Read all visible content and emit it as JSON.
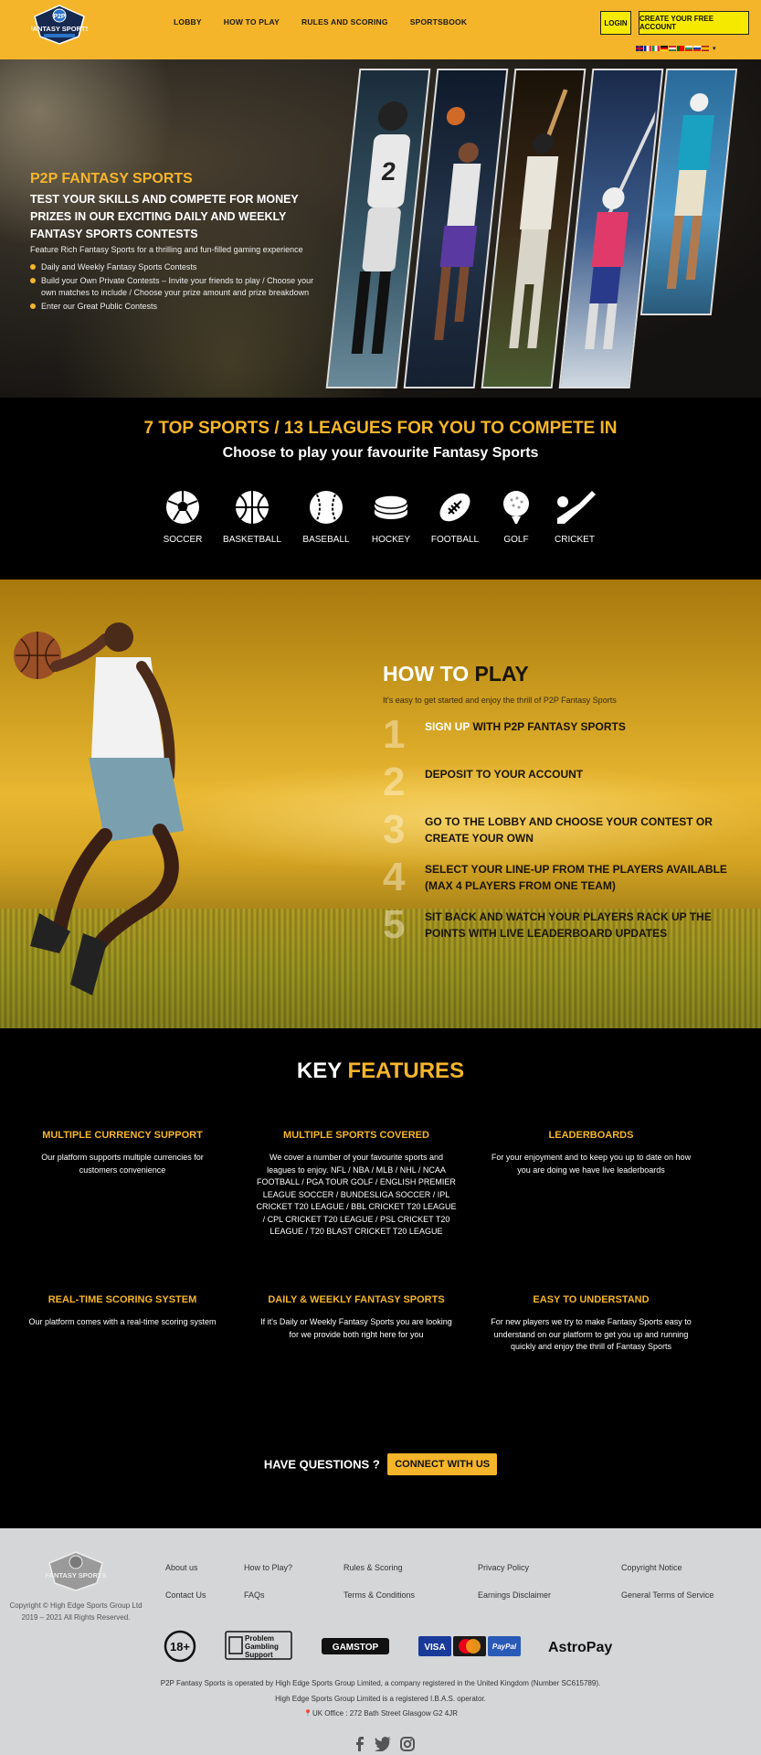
{
  "header": {
    "logo_text": "FANTASY SPORTS",
    "nav": [
      "LOBBY",
      "HOW TO PLAY",
      "RULES AND SCORING",
      "SPORTSBOOK"
    ],
    "login_label": "LOGIN",
    "create_label": "CREATE YOUR FREE ACCOUNT",
    "language_flags": [
      "en",
      "fr",
      "it",
      "de",
      "hu",
      "pt",
      "bg",
      "ru",
      "es"
    ]
  },
  "hero": {
    "title": "P2P FANTASY SPORTS",
    "subtitle": "TEST YOUR SKILLS AND COMPETE FOR MONEY PRIZES IN OUR EXCITING DAILY AND WEEKLY FANTASY SPORTS CONTESTS",
    "description": "Feature Rich Fantasy Sports for a thrilling and fun-filled gaming experience",
    "bullets": [
      "Daily and Weekly Fantasy Sports Contests",
      "Build your Own Private Contests – Invite your friends to play / Choose your own matches to include / Choose your prize amount and prize breakdown",
      "Enter our Great Public Contests"
    ]
  },
  "sports": {
    "title": "7 TOP SPORTS / 13 LEAGUES FOR YOU TO COMPETE IN",
    "subtitle": "Choose to play your favourite Fantasy Sports",
    "items": [
      {
        "label": "SOCCER",
        "icon": "soccer-ball-icon"
      },
      {
        "label": "BASKETBALL",
        "icon": "basketball-icon"
      },
      {
        "label": "BASEBALL",
        "icon": "baseball-icon"
      },
      {
        "label": "HOCKEY",
        "icon": "hockey-puck-icon"
      },
      {
        "label": "FOOTBALL",
        "icon": "football-icon"
      },
      {
        "label": "GOLF",
        "icon": "golf-ball-icon"
      },
      {
        "label": "CRICKET",
        "icon": "cricket-bat-icon"
      }
    ]
  },
  "howto": {
    "title_a": "HOW TO",
    "title_b": "PLAY",
    "intro": "It's easy to get started and enjoy the thrill of P2P Fantasy Sports",
    "steps": [
      {
        "num": "1",
        "highlight": "SIGN UP",
        "text": " WITH P2P FANTASY SPORTS"
      },
      {
        "num": "2",
        "highlight": "",
        "text": "DEPOSIT TO YOUR ACCOUNT"
      },
      {
        "num": "3",
        "highlight": "",
        "text": "GO TO THE LOBBY AND CHOOSE YOUR CONTEST OR CREATE YOUR OWN"
      },
      {
        "num": "4",
        "highlight": "",
        "text": "SELECT YOUR LINE-UP FROM THE PLAYERS AVAILABLE (MAX 4 PLAYERS FROM ONE TEAM)"
      },
      {
        "num": "5",
        "highlight": "",
        "text": "SIT BACK AND WATCH YOUR PLAYERS RACK UP THE POINTS WITH LIVE LEADERBOARD UPDATES"
      }
    ]
  },
  "features": {
    "title_a": "KEY",
    "title_b": "FEATURES",
    "items": [
      {
        "title": "MULTIPLE CURRENCY SUPPORT",
        "text": "Our platform supports multiple currencies for customers convenience"
      },
      {
        "title": "MULTIPLE SPORTS COVERED",
        "text": "We cover a number of your favourite sports and leagues to enjoy. NFL / NBA / MLB / NHL / NCAA FOOTBALL / PGA TOUR GOLF / ENGLISH PREMIER LEAGUE SOCCER / BUNDESLIGA SOCCER / IPL CRICKET T20 LEAGUE / BBL CRICKET T20 LEAGUE / CPL CRICKET T20 LEAGUE / PSL CRICKET T20 LEAGUE / T20 BLAST CRICKET T20 LEAGUE"
      },
      {
        "title": "LEADERBOARDS",
        "text": "For your enjoyment and to keep you up to date on how you are doing we have live leaderboards"
      },
      {
        "title": "REAL-TIME SCORING SYSTEM",
        "text": "Our platform comes with a real-time scoring system"
      },
      {
        "title": "DAILY & WEEKLY FANTASY SPORTS",
        "text": "If it's Daily or Weekly Fantasy Sports you are looking for we provide both right here for you"
      },
      {
        "title": "EASY TO UNDERSTAND",
        "text": "For new players we try to make Fantasy Sports easy to understand on our platform to get you up and running quickly and enjoy the thrill of Fantasy Sports"
      }
    ],
    "questions_text": "HAVE QUESTIONS ?",
    "connect_label": "CONNECT WITH US"
  },
  "footer": {
    "copyright_1": "Copyright © High Edge Sports Group Ltd",
    "copyright_2": "2019 – 2021 All Rights Reserved.",
    "links": {
      "about": "About us",
      "contact": "Contact Us",
      "howto": "How to Play?",
      "faqs": "FAQs",
      "rules": "Rules & Scoring",
      "terms": "Terms & Conditions",
      "privacy": "Privacy Policy",
      "earnings": "Earnings Disclaimer",
      "copyright_notice": "Copyright Notice",
      "general_terms": "General Terms of Service"
    },
    "badges": {
      "age": "18+",
      "gambling_support_1": "Problem",
      "gambling_support_2": "Gambling",
      "gambling_support_3": "Support",
      "gamstop": "GAMSTOP",
      "visa": "VISA",
      "paypal": "PayPal",
      "astropay": "AstroPay"
    },
    "legal_1": "P2P Fantasy Sports is operated by High Edge Sports Group Limited, a company registered in the United Kingdom (Number SC615789).",
    "legal_2": "High Edge Sports Group Limited is a registered I.B.A.S. operator.",
    "address": "UK Office : 272 Bath Street Glasgow G2 4JR"
  },
  "colors": {
    "brand_yellow": "#f5b52a",
    "button_yellow": "#f6e900",
    "footer_bg": "#d4d6d7"
  }
}
